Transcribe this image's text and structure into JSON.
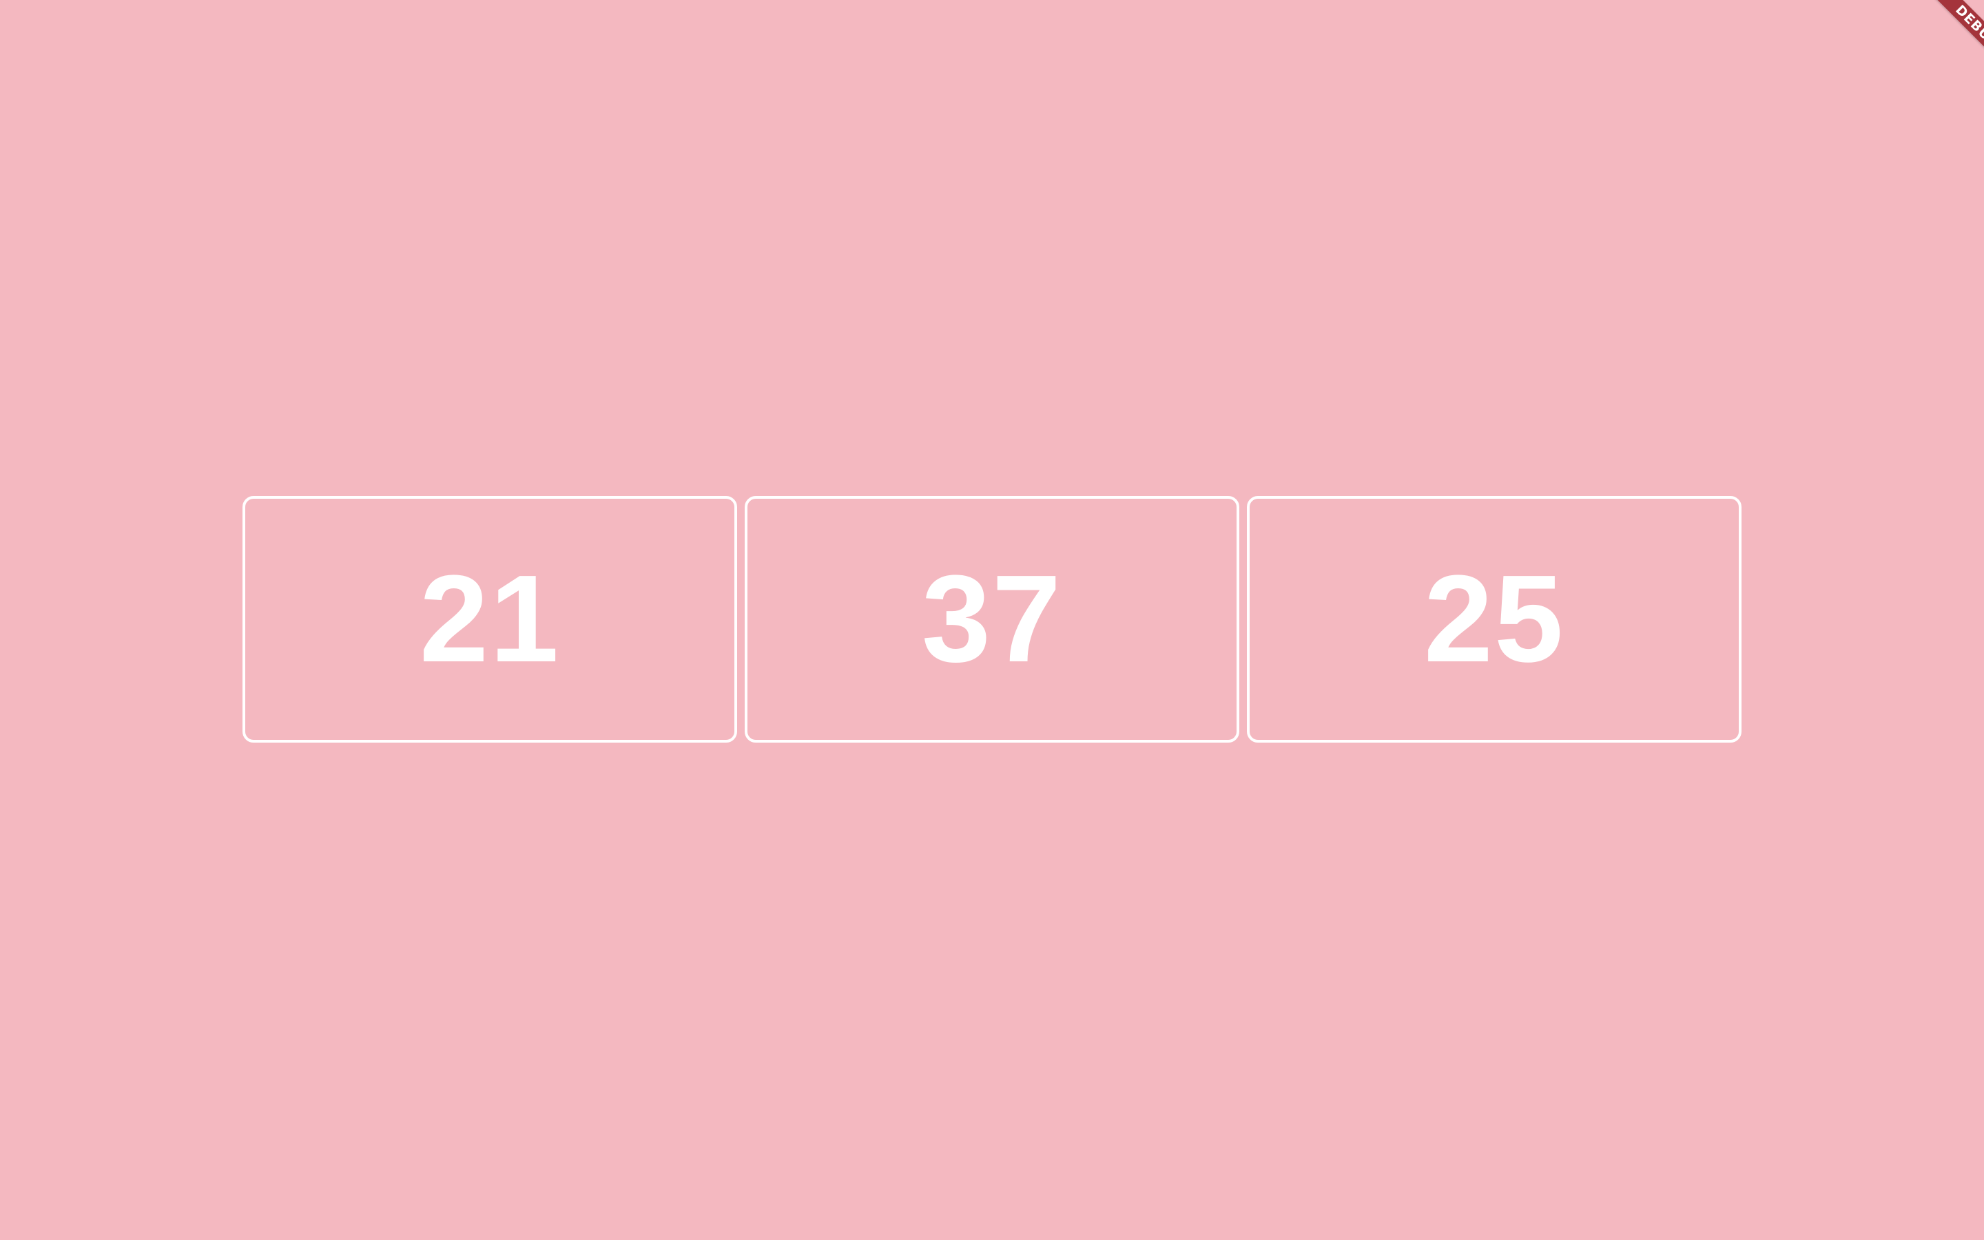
{
  "colors": {
    "background": "#f4b8c0",
    "card_border": "#ffffff",
    "card_text": "#ffffff",
    "debug_banner": "#a4343b"
  },
  "counters": [
    {
      "value": "21"
    },
    {
      "value": "37"
    },
    {
      "value": "25"
    }
  ],
  "debug_banner": {
    "label": "DEBUG"
  }
}
